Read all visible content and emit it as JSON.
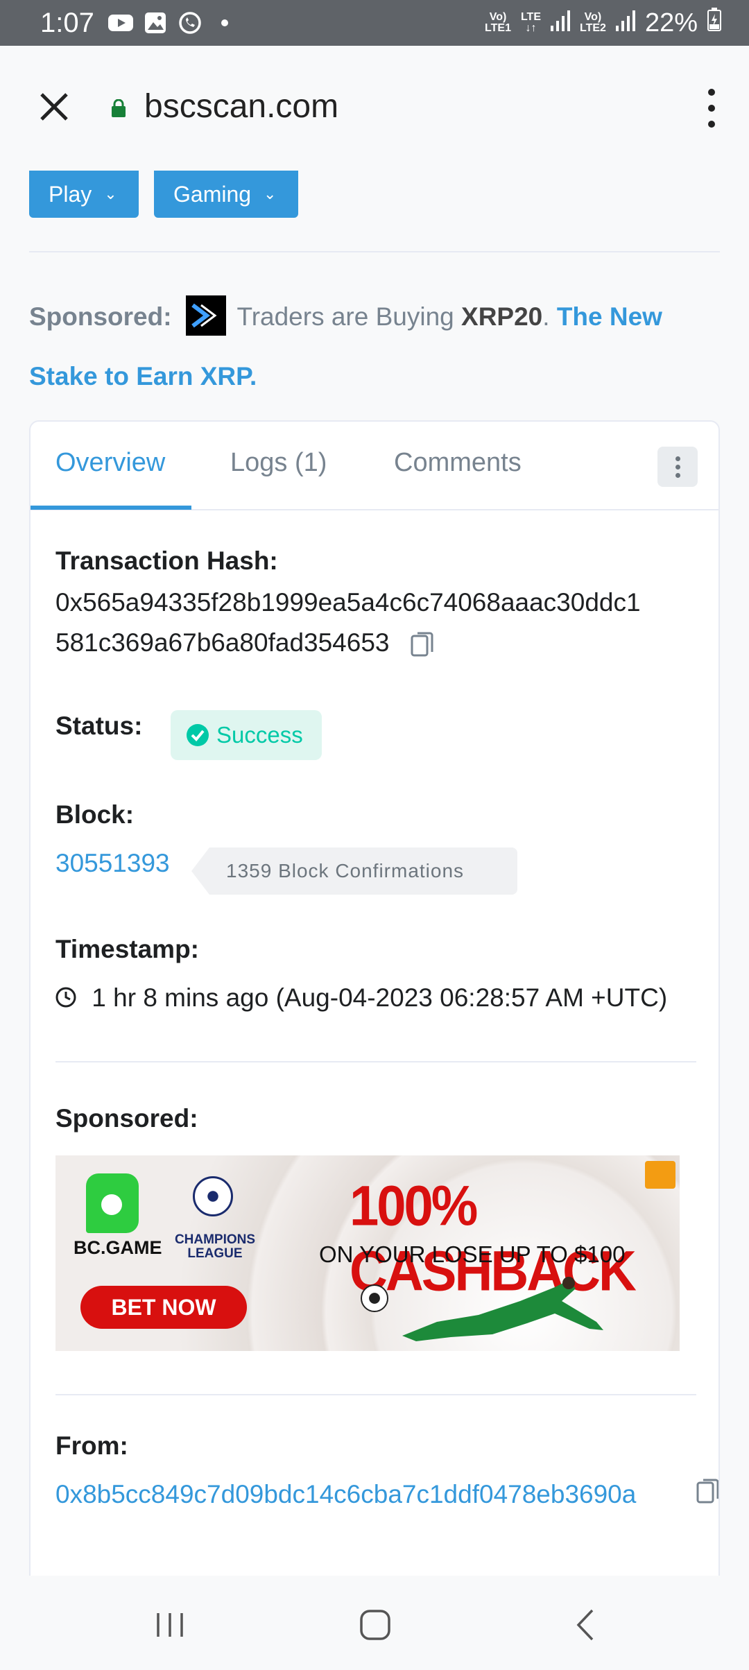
{
  "status_bar": {
    "time": "1:07",
    "net1_top": "Vo)",
    "net1_bottom": "LTE1",
    "lte": "LTE",
    "net2_top": "Vo)",
    "net2_bottom": "LTE2",
    "battery": "22%"
  },
  "browser": {
    "url": "bscscan.com"
  },
  "top_buttons": {
    "play": "Play",
    "gaming": "Gaming"
  },
  "sponsored_banner": {
    "label": "Sponsored:",
    "text_before": "Traders are Buying",
    "strong": "XRP20",
    "dot": ".",
    "link": "The New Stake to Earn XRP."
  },
  "tabs": [
    {
      "label": "Overview",
      "active": true
    },
    {
      "label": "Logs (1)",
      "active": false
    },
    {
      "label": "Comments",
      "active": false
    }
  ],
  "transaction": {
    "hash_label": "Transaction Hash:",
    "hash_line1": "0x565a94335f28b1999ea5a4c6c74068aaac30ddc1",
    "hash_line2": "581c369a67b6a80fad354653",
    "status_label": "Status:",
    "status_value": "Success",
    "block_label": "Block:",
    "block_number": "30551393",
    "block_confirmations": "1359 Block Confirmations",
    "timestamp_label": "Timestamp:",
    "timestamp_value": "1 hr 8 mins ago (Aug-04-2023 06:28:57 AM +UTC)",
    "sponsored_label": "Sponsored:",
    "from_label": "From:",
    "from_address": "0x8b5cc849c7d09bdc14c6cba7c1ddf0478eb3690a"
  },
  "ad": {
    "brand": "BC.GAME",
    "league": "CHAMPIONS LEAGUE",
    "headline": "100% CASHBACK",
    "subline": "ON YOUR LOSE UP TO $100",
    "cta": "BET NOW"
  },
  "colors": {
    "link": "#3498db",
    "success": "#00c9a7",
    "ad_red": "#d8100f"
  }
}
